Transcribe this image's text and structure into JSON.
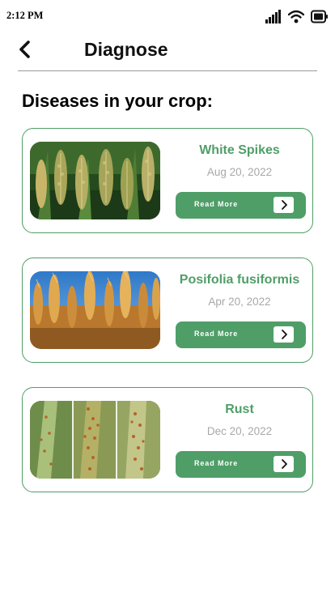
{
  "status_bar": {
    "time": "2:12 PM",
    "icons": [
      "signal-icon",
      "wifi-icon",
      "battery-icon"
    ]
  },
  "header": {
    "title": "Diagnose",
    "back_icon": "chevron-left-icon"
  },
  "section_heading": "Diseases in your crop:",
  "colors": {
    "accent": "#4f9e68",
    "date_text": "#a8a8a8",
    "divider": "#9a9a9a"
  },
  "diseases": [
    {
      "title": "White Spikes",
      "date": "Aug 20, 2022",
      "button_label": "Read More",
      "button_icon": "chevron-right-icon"
    },
    {
      "title": "Posifolia fusiformis",
      "date": "Apr 20, 2022",
      "button_label": "Read More",
      "button_icon": "chevron-right-icon"
    },
    {
      "title": "Rust",
      "date": "Dec 20, 2022",
      "button_label": "Read More",
      "button_icon": "chevron-right-icon"
    }
  ]
}
